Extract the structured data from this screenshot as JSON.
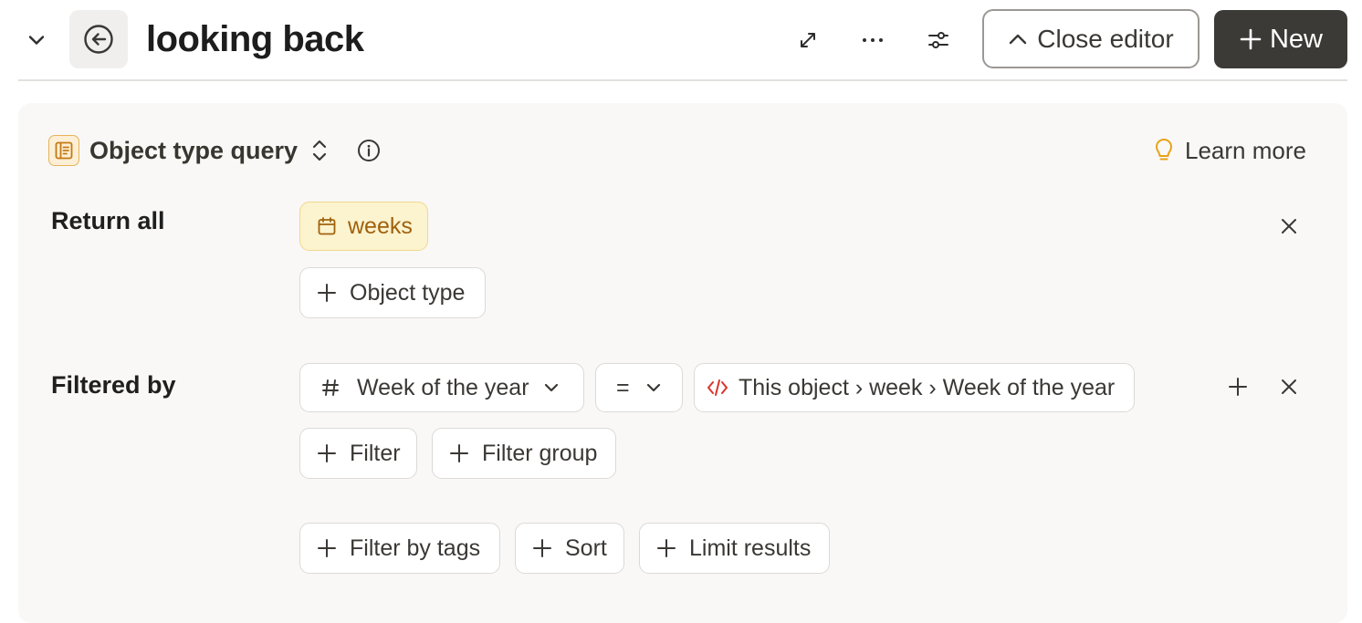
{
  "header": {
    "title": "looking back",
    "close_editor_label": "Close editor",
    "new_label": "New"
  },
  "query": {
    "type_label": "Object type query",
    "learn_more_label": "Learn more",
    "return_all_label": "Return all",
    "object_types": [
      "weeks"
    ],
    "add_object_type_label": "Object type",
    "filtered_by_label": "Filtered by",
    "filter": {
      "property": "Week of the year",
      "operator": "=",
      "value": "This object › week › Week of the year"
    },
    "add_filter_label": "Filter",
    "add_filter_group_label": "Filter group",
    "filter_by_tags_label": "Filter by tags",
    "sort_label": "Sort",
    "limit_results_label": "Limit results"
  },
  "colors": {
    "accent_dark": "#3c3a36",
    "object_chip_bg": "#fcf3cf",
    "object_chip_text": "#a0620c",
    "code_icon": "#d9342b"
  },
  "icons": {
    "collapse": "chevron-down-icon",
    "back": "arrow-left-circle-icon",
    "expand": "expand-icon",
    "more": "more-horizontal-icon",
    "settings": "sliders-icon",
    "close_editor": "chevron-up-icon",
    "new": "plus-icon",
    "query_type": "document-icon",
    "info": "info-icon",
    "learn_more": "lightbulb-icon",
    "object_type": "calendar-icon",
    "property": "hash-icon",
    "value": "code-icon"
  }
}
